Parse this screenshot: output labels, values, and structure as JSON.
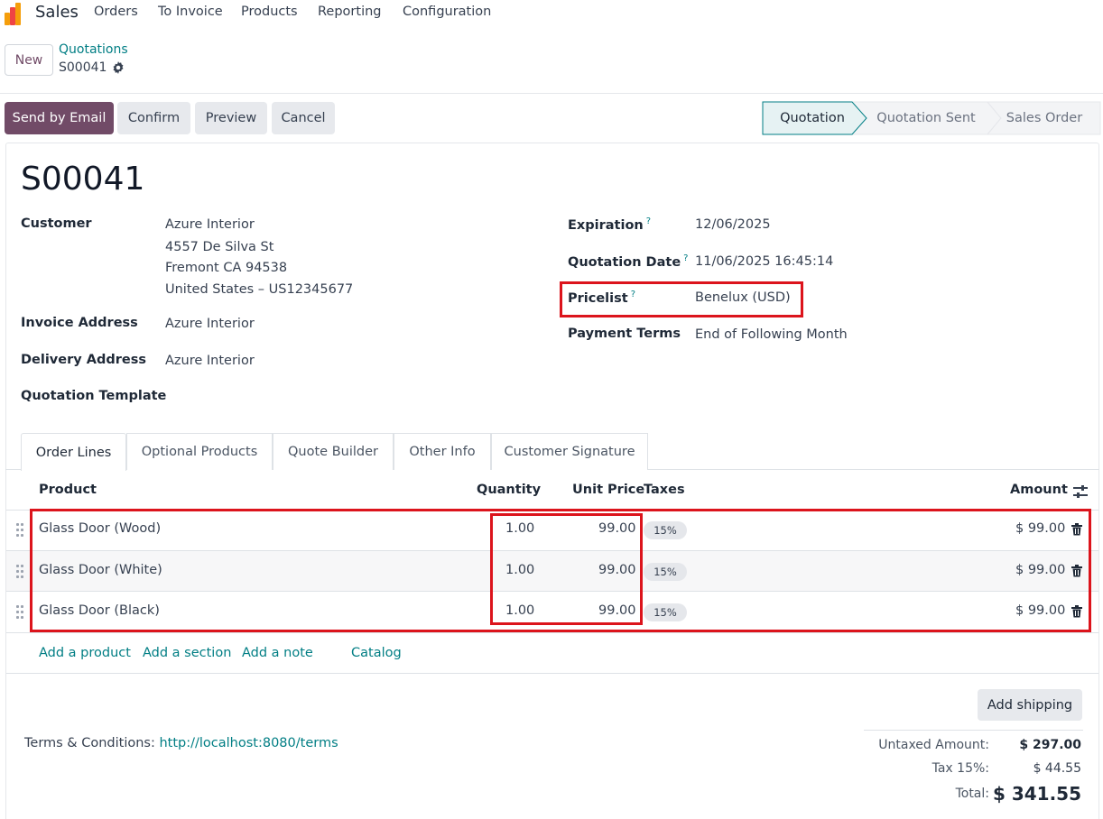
{
  "nav": {
    "app": "Sales",
    "menu": [
      "Orders",
      "To Invoice",
      "Products",
      "Reporting",
      "Configuration"
    ]
  },
  "breadcrumb": {
    "new_label": "New",
    "parent": "Quotations",
    "current": "S00041"
  },
  "actions": {
    "send_email": "Send by Email",
    "confirm": "Confirm",
    "preview": "Preview",
    "cancel": "Cancel"
  },
  "status": {
    "steps": [
      "Quotation",
      "Quotation Sent",
      "Sales Order"
    ],
    "active": "Quotation"
  },
  "order": {
    "title": "S00041",
    "customer_label": "Customer",
    "customer_name": "Azure Interior",
    "customer_addr1": "4557 De Silva St",
    "customer_addr2": "Fremont CA 94538",
    "customer_addr3": "United States – US12345677",
    "invoice_label": "Invoice Address",
    "invoice_value": "Azure Interior",
    "delivery_label": "Delivery Address",
    "delivery_value": "Azure Interior",
    "template_label": "Quotation Template",
    "expiration_label": "Expiration",
    "expiration_value": "12/06/2025",
    "qdate_label": "Quotation Date",
    "qdate_value": "11/06/2025 16:45:14",
    "pricelist_label": "Pricelist",
    "pricelist_value": "Benelux (USD)",
    "terms_label": "Payment Terms",
    "terms_value": "End of Following Month",
    "help_mark": "?"
  },
  "tabs": [
    "Order Lines",
    "Optional Products",
    "Quote Builder",
    "Other Info",
    "Customer Signature"
  ],
  "lines": {
    "headers": {
      "product": "Product",
      "quantity": "Quantity",
      "unit_price": "Unit Price",
      "taxes": "Taxes",
      "amount": "Amount"
    },
    "rows": [
      {
        "product": "Glass Door (Wood)",
        "quantity": "1.00",
        "unit_price": "99.00",
        "tax": "15%",
        "amount": "$ 99.00"
      },
      {
        "product": "Glass Door (White)",
        "quantity": "1.00",
        "unit_price": "99.00",
        "tax": "15%",
        "amount": "$ 99.00"
      },
      {
        "product": "Glass Door (Black)",
        "quantity": "1.00",
        "unit_price": "99.00",
        "tax": "15%",
        "amount": "$ 99.00"
      }
    ],
    "add_product": "Add a product",
    "add_section": "Add a section",
    "add_note": "Add a note",
    "catalog": "Catalog"
  },
  "footer": {
    "add_shipping": "Add shipping",
    "terms_label": "Terms & Conditions:",
    "terms_link": "http://localhost:8080/terms",
    "untaxed_label": "Untaxed Amount:",
    "untaxed_value": "$ 297.00",
    "tax_label": "Tax 15%:",
    "tax_value": "$ 44.55",
    "total_label": "Total:",
    "total_value": "$ 341.55"
  },
  "colors": {
    "primary": "#714B67",
    "link": "#017e84",
    "highlight": "#dc141c"
  }
}
